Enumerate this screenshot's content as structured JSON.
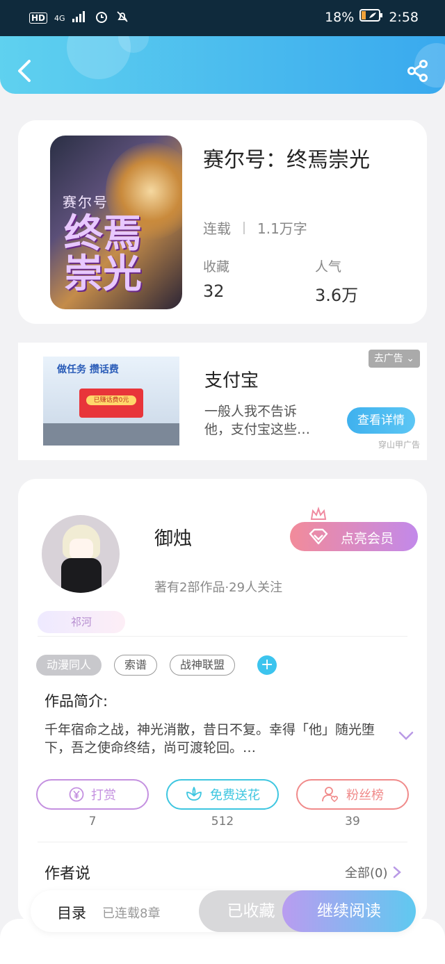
{
  "status_bar": {
    "network": "HD",
    "signal": "4G",
    "battery_percent": "18%",
    "time": "2:58"
  },
  "header": {
    "back_icon": "chevron-left-icon",
    "share_icon": "share-icon",
    "gradient_start": "#5fd1ef",
    "gradient_end": "#39a9ee"
  },
  "book": {
    "title": "赛尔号：终焉崇光",
    "cover_subtitle": "赛尔号",
    "cover_title": "终焉\n崇光",
    "status": "连载",
    "word_count": "1.1万字",
    "favorites_label": "收藏",
    "favorites_value": "32",
    "popularity_label": "人气",
    "popularity_value": "3.6万"
  },
  "ad": {
    "banner_text": "做任务 攒话费",
    "envelope_text": "已赚话费0元",
    "name": "支付宝",
    "description": "一般人我不告诉他，支付宝这些…",
    "close_label": "去广告",
    "cta_label": "查看详情",
    "source": "穿山甲广告"
  },
  "author": {
    "name": "御烛",
    "stats": "著有2部作品·29人关注",
    "vip_label": "点亮会员",
    "badge": "祁河",
    "tags": [
      "动漫同人",
      "索谱",
      "战神联盟"
    ],
    "intro_title": "作品简介:",
    "intro_text": "千年宿命之战，神光消散，昔日不复。幸得「他」随光堕下，吾之使命终结，尚可渡轮回。…",
    "actions": [
      {
        "label": "打赏",
        "count": "7",
        "color": "#c490e0",
        "icon": "yuan-coin-icon"
      },
      {
        "label": "免费送花",
        "count": "512",
        "color": "#3ec6e0",
        "icon": "flower-icon"
      },
      {
        "label": "粉丝榜",
        "count": "39",
        "color": "#f08a8a",
        "icon": "fan-ranking-icon"
      }
    ],
    "say_title": "作者说",
    "say_all": "全部(0)"
  },
  "bottom_bar": {
    "toc_label": "目录",
    "toc_status": "已连载8章",
    "fav_label": "已收藏",
    "read_label": "继续阅读"
  }
}
